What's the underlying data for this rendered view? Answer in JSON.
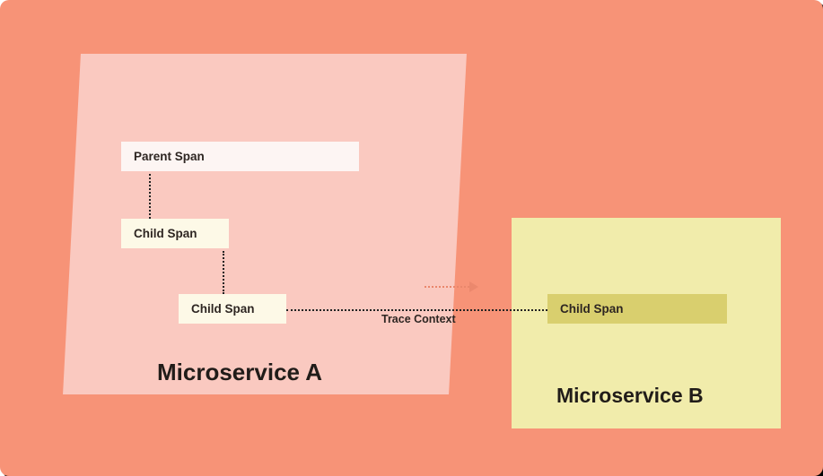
{
  "diagram": {
    "service_a": {
      "title": "Microservice A",
      "parent_span": "Parent Span",
      "child_span_1": "Child Span",
      "child_span_2": "Child Span"
    },
    "service_b": {
      "title": "Microservice B",
      "child_span": "Child Span"
    },
    "connector_label": "Trace Context"
  },
  "colors": {
    "background": "#f79377",
    "service_a_bg": "#fac9c0",
    "service_b_bg": "#f1ecab",
    "span_light": "#fdf9e7",
    "span_parent": "#fdf5f3",
    "span_b": "#d9cf6e"
  }
}
